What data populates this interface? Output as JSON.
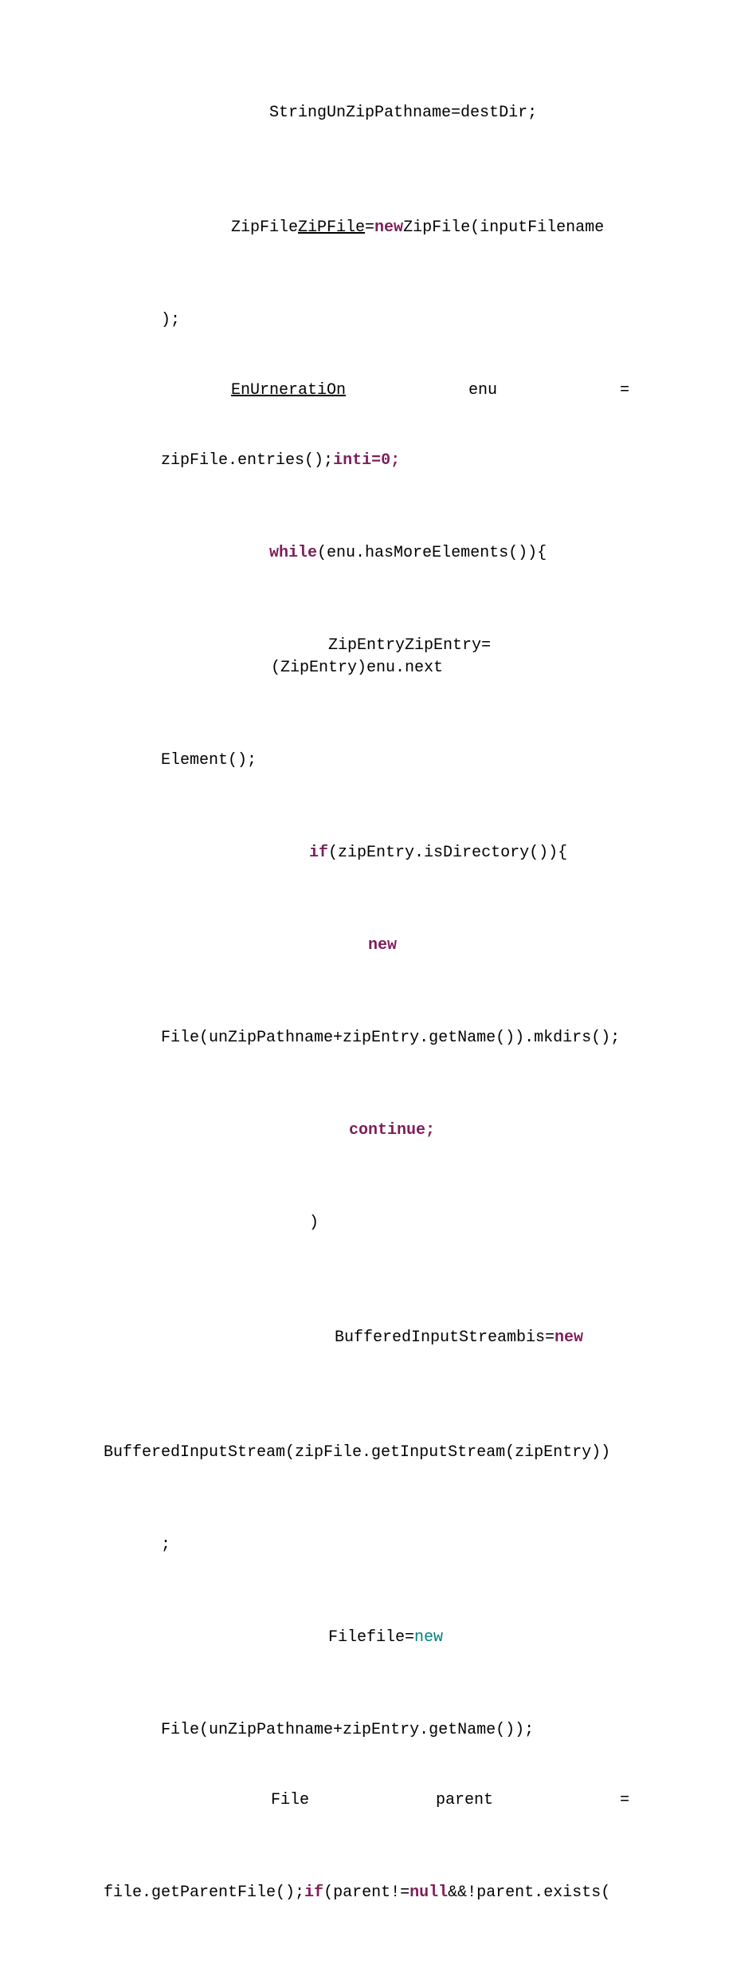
{
  "code": {
    "l1_a": "StringUnZipPathname=destDir;",
    "l2_a": "ZipFile",
    "l2_b": "ZiPFile",
    "l2_c": "=",
    "l2_d": "new",
    "l2_e": "ZipFile(inputFilename",
    "l2_f": ");",
    "l3_a": "EnUrneratiOn",
    "l3_b": "enu",
    "l3_c": "=",
    "l3_d": "zipFile.entries();",
    "l3_e": "int",
    "l3_f": "i=0;",
    "l4_a": "while",
    "l4_b": "(enu.",
    "l4_c": "hasMoreElements()){",
    "l5_a": "ZipEntryZipEntry=(ZipEntry)enu.next",
    "l5_b": "Element();",
    "l6_a": "if",
    "l6_b": "(zipEntry.isDirectory()){",
    "l7_a": "new",
    "l8_a": "File(unZipPathname+zipEntry.getName()).mkdirs();",
    "l9_a": "continue",
    "l9_b": ";",
    "l10_a": ")",
    "l11_a": "BufferedInputStreambis=",
    "l11_b": "new",
    "l11_c": "BufferedInputStream(zipFile.getInputStream(zipEntry))",
    "l11_d": ";",
    "l12_a": "Filefile=",
    "l12_b": "new",
    "l13_a": "File(unZipPathname+zipEntry.getName());",
    "l14_a": "File",
    "l14_b": "parent",
    "l14_c": "=",
    "l15_a": "file.getParentFile();",
    "l15_b": "if",
    "l15_c": "(parent!=",
    "l15_d": "null",
    "l15_e": "&&!parent.exists("
  }
}
